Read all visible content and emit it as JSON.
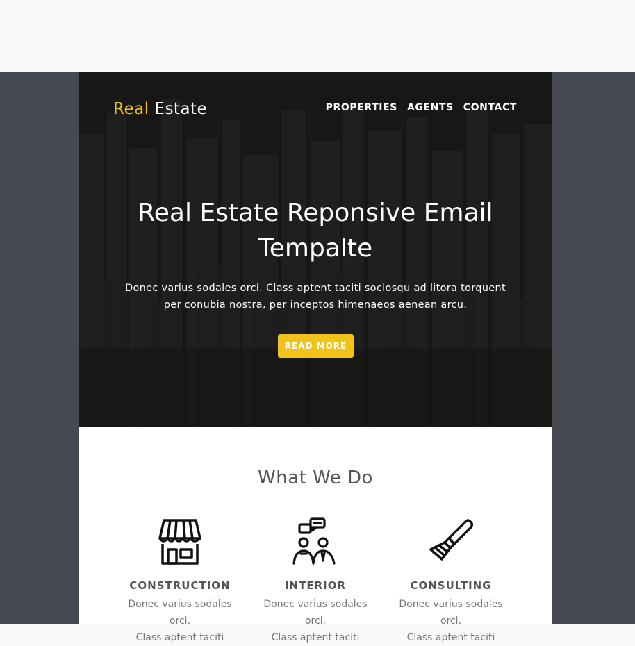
{
  "colors": {
    "accent": "#f0c21a",
    "page_bg": "#454950",
    "text_dark": "#555555"
  },
  "header": {
    "logo_part1": "Real",
    "logo_part2": "Estate",
    "nav": [
      "PROPERTIES",
      "AGENTS",
      "CONTACT"
    ]
  },
  "hero": {
    "title_line1": "Real Estate Reponsive Email",
    "title_line2": "Tempalte",
    "text_line1": "Donec varius sodales orci. Class aptent taciti sociosqu ad litora torquent",
    "text_line2": "per conubia nostra, per inceptos himenaeos aenean arcu.",
    "button": "READ MORE"
  },
  "services": {
    "title": "What We Do",
    "items": [
      {
        "label": "CONSTRUCTION",
        "icon": "storefront-icon",
        "desc_line1": "Donec varius sodales orci.",
        "desc_line2": "Class aptent taciti"
      },
      {
        "label": "INTERIOR",
        "icon": "meeting-people-icon",
        "desc_line1": "Donec varius sodales orci.",
        "desc_line2": "Class aptent taciti"
      },
      {
        "label": "CONSULTING",
        "icon": "paint-brush-icon",
        "desc_line1": "Donec varius sodales orci.",
        "desc_line2": "Class aptent taciti"
      }
    ]
  }
}
